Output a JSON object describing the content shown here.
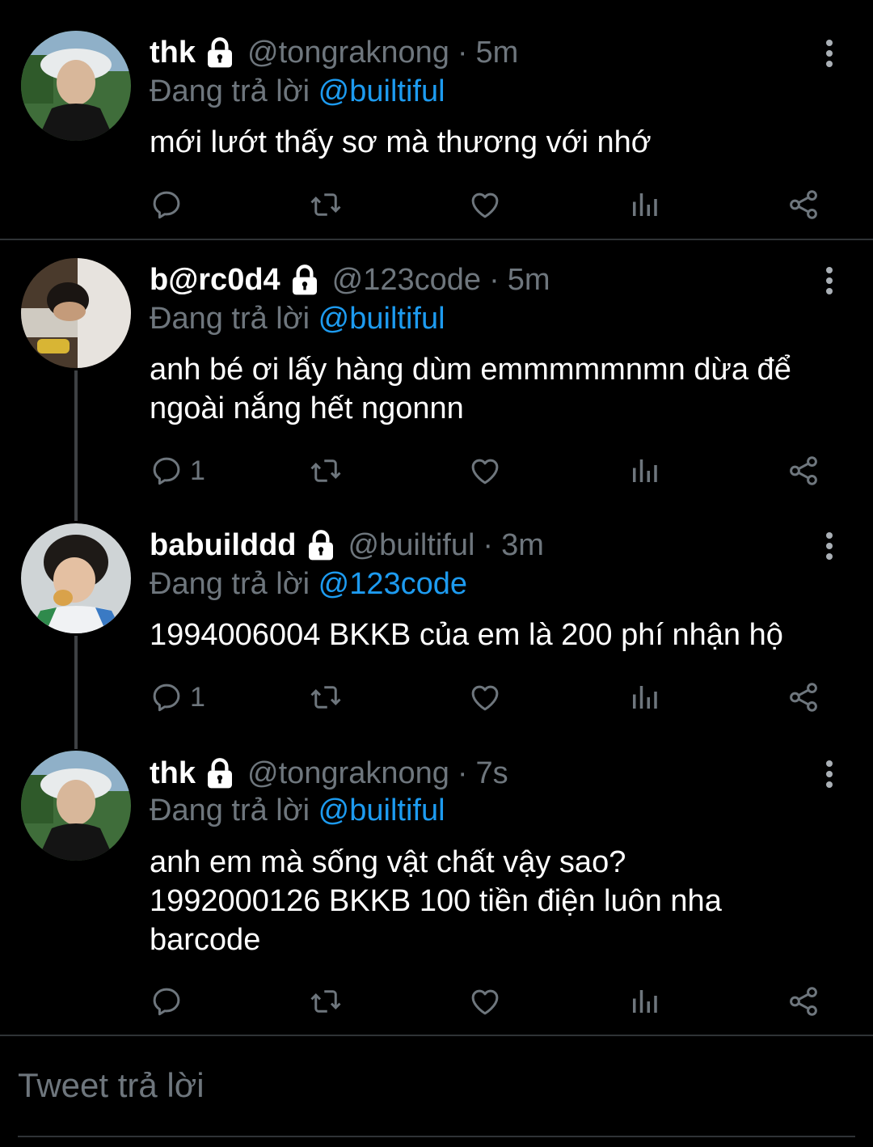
{
  "tweets": [
    {
      "name": "thk",
      "handle": "@tongraknong",
      "time": "5m",
      "replying_label": "Đang trả lời",
      "replying_to": "@builtiful",
      "lines": [
        "mới lướt thấy sơ mà thương với nhớ"
      ],
      "reply_count": ""
    },
    {
      "name": "b@rc0d4",
      "handle": "@123code",
      "time": "5m",
      "replying_label": "Đang trả lời",
      "replying_to": "@builtiful",
      "lines": [
        "anh bé ơi lấy hàng dùm emmmmmnmn dừa để",
        "ngoài nắng hết ngonnn"
      ],
      "reply_count": "1"
    },
    {
      "name": "babuilddd",
      "handle": "@builtiful",
      "time": "3m",
      "replying_label": "Đang trả lời",
      "replying_to": "@123code",
      "lines": [
        "1994006004 BKKB của em là 200 phí nhận hộ"
      ],
      "reply_count": "1"
    },
    {
      "name": "thk",
      "handle": "@tongraknong",
      "time": "7s",
      "replying_label": "Đang trả lời",
      "replying_to": "@builtiful",
      "lines": [
        "anh em mà sống vật chất vậy sao?",
        "1992000126 BKKB 100 tiền điện luôn nha",
        "barcode"
      ],
      "reply_count": ""
    }
  ],
  "icons": {
    "lock": "lock-icon",
    "more": "more-vertical-icon",
    "reply": "reply-icon",
    "retweet": "retweet-icon",
    "like": "heart-icon",
    "views": "views-icon",
    "share": "share-icon"
  },
  "colors": {
    "background": "#000000",
    "text": "#ffffff",
    "muted": "#6e767d",
    "link": "#1d9bf0",
    "divider": "#2f3336"
  },
  "compose": {
    "placeholder": "Tweet trả lời"
  }
}
